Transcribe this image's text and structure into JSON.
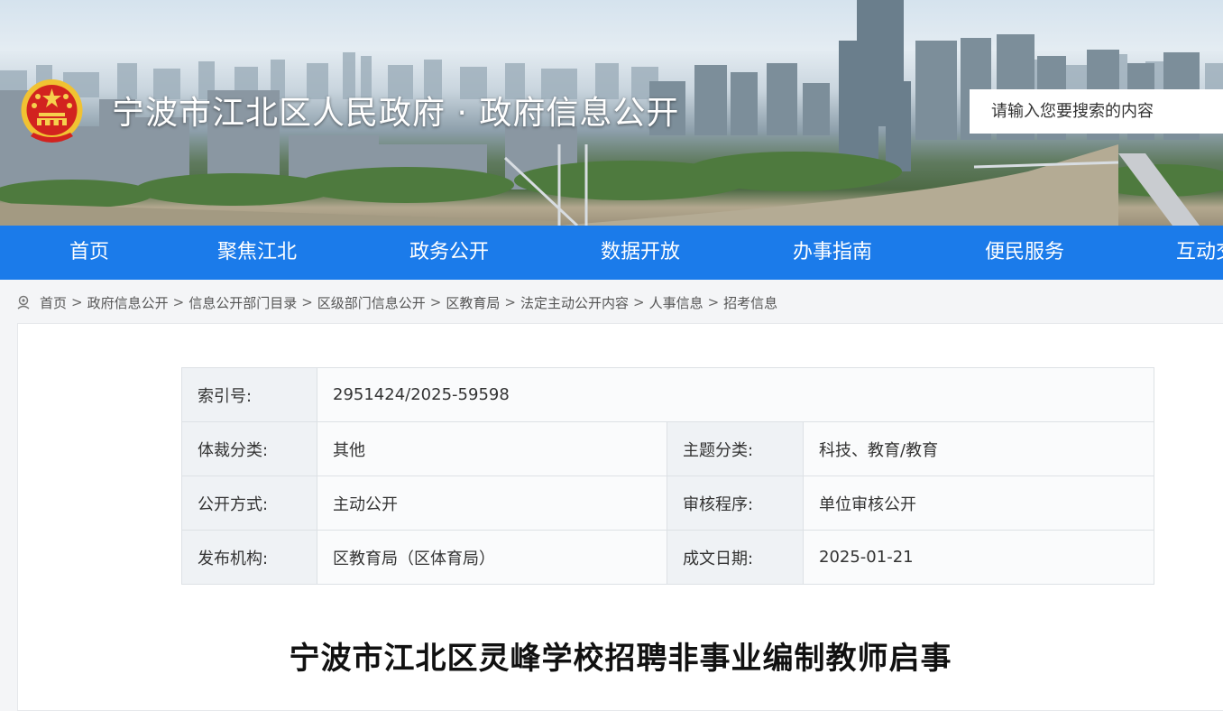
{
  "header": {
    "site_title": "宁波市江北区人民政府 · 政府信息公开",
    "search_placeholder": "请输入您要搜索的内容",
    "emblem_icon": "national-emblem-icon"
  },
  "nav": {
    "items": [
      "首页",
      "聚焦江北",
      "政务公开",
      "数据开放",
      "办事指南",
      "便民服务",
      "互动交流"
    ],
    "background": "#1b7bea"
  },
  "breadcrumb": {
    "icon": "location-pin-icon",
    "separator": ">",
    "items": [
      "首页",
      "政府信息公开",
      "信息公开部门目录",
      "区级部门信息公开",
      "区教育局",
      "法定主动公开内容",
      "人事信息",
      "招考信息"
    ]
  },
  "meta": {
    "index_label": "索引号:",
    "index_value": "2951424/2025-59598",
    "genre_label": "体裁分类:",
    "genre_value": "其他",
    "topic_label": "主题分类:",
    "topic_value": "科技、教育/教育",
    "method_label": "公开方式:",
    "method_value": "主动公开",
    "review_label": "审核程序:",
    "review_value": "单位审核公开",
    "org_label": "发布机构:",
    "org_value": "区教育局（区体育局）",
    "date_label": "成文日期:",
    "date_value": "2025-01-21"
  },
  "article": {
    "title": "宁波市江北区灵峰学校招聘非事业编制教师启事"
  }
}
